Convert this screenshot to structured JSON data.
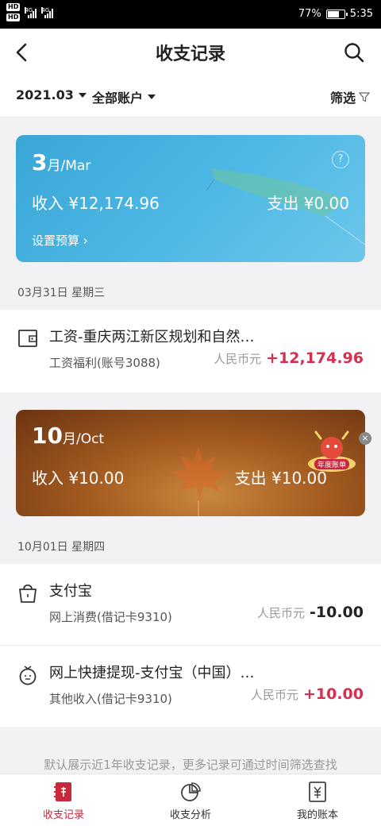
{
  "status_bar": {
    "hd_1": "HD",
    "hd_2": "HD",
    "signal_1": "4G",
    "signal_2": "4G",
    "battery_percent": "77%",
    "battery_level": 0.77,
    "time": "5:35"
  },
  "header": {
    "title": "收支记录",
    "back_icon": "chevron-left-icon",
    "search_icon": "search-icon"
  },
  "filters": {
    "month": "2021.03",
    "account": "全部账户",
    "filter_label": "筛选"
  },
  "colors": {
    "accent_red": "#d43050",
    "nav_active": "#c8283c",
    "march_card": "#3aa6d6",
    "october_card": "#a35a1f"
  },
  "months": [
    {
      "month_num": "3",
      "month_unit": "月/Mar",
      "income": "收入 ¥12,174.96",
      "expense": "支出 ¥0.00",
      "budget_link": "设置预算 ›",
      "date_header": "03月31日 星期三",
      "transactions": [
        {
          "icon": "wallet-icon",
          "title": "工资-重庆两江新区规划和自然…",
          "subtitle": "工资福利(账号3088)",
          "currency": "人民币元",
          "amount": "+12,174.96"
        }
      ]
    },
    {
      "month_num": "10",
      "month_unit": "月/Oct",
      "income": "收入 ¥10.00",
      "expense": "支出 ¥10.00",
      "date_header": "10月01日 星期四",
      "transactions": [
        {
          "icon": "shopping-bag-icon",
          "title": "支付宝",
          "subtitle": "网上消费(借记卡9310)",
          "currency": "人民币元",
          "amount": "-10.00"
        },
        {
          "icon": "money-bag-icon",
          "title": "网上快捷提现-支付宝（中国）…",
          "subtitle": "其他收入(借记卡9310)",
          "currency": "人民币元",
          "amount": "+10.00"
        }
      ]
    }
  ],
  "promo": {
    "badge_text": "年度账单",
    "close": "×"
  },
  "footer_note": "默认展示近1年收支记录，更多记录可通过时间筛选查找",
  "bottom_nav": [
    {
      "label": "收支记录",
      "icon": "ledger-icon",
      "active": true
    },
    {
      "label": "收支分析",
      "icon": "pie-chart-icon",
      "active": false
    },
    {
      "label": "我的账本",
      "icon": "account-book-icon",
      "active": false
    }
  ]
}
